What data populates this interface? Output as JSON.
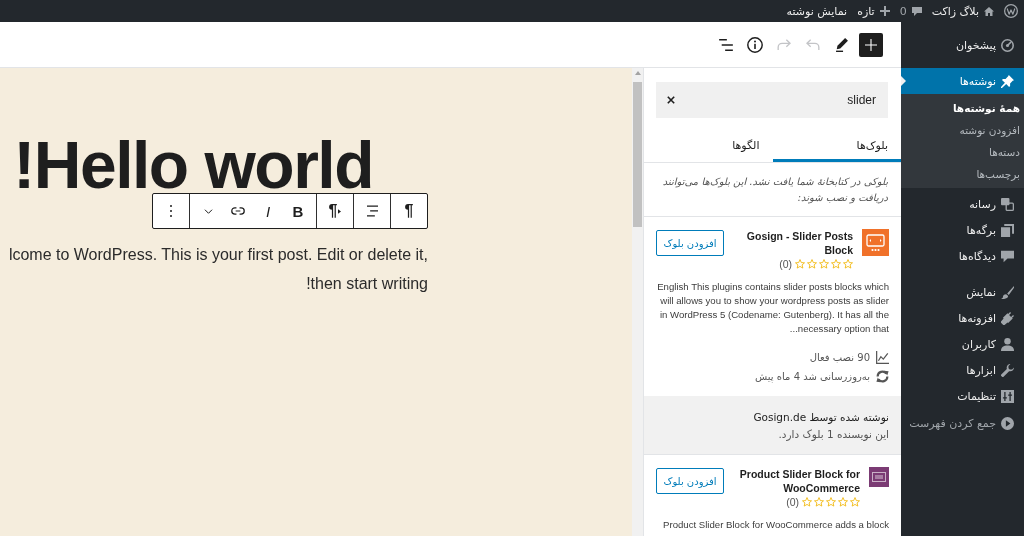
{
  "admin_bar": {
    "site_name": "بلاگ زاکت",
    "comments_count": "0",
    "new_label": "تازه",
    "view_post": "نمایش نوشته"
  },
  "sidebar": {
    "groups": [
      {
        "items": [
          {
            "label": "پیشخوان",
            "selected": false
          }
        ]
      },
      {
        "items": [
          {
            "label": "نوشته‌ها",
            "selected": true,
            "children": [
              {
                "label": "همهٔ نوشته‌ها",
                "selected": true
              },
              {
                "label": "افزودن نوشته",
                "selected": false
              },
              {
                "label": "دسته‌ها",
                "selected": false
              },
              {
                "label": "برچسب‌ها",
                "selected": false
              }
            ]
          },
          {
            "label": "رسانه",
            "selected": false
          },
          {
            "label": "برگه‌ها",
            "selected": false
          },
          {
            "label": "دیدگاه‌ها",
            "selected": false
          }
        ]
      },
      {
        "items": [
          {
            "label": "نمایش",
            "selected": false
          },
          {
            "label": "افزونه‌ها",
            "selected": false
          },
          {
            "label": "کاربران",
            "selected": false
          },
          {
            "label": "ابزارها",
            "selected": false
          },
          {
            "label": "تنظیمات",
            "selected": false
          }
        ]
      }
    ],
    "collapse_label": "جمع کردن فهرست"
  },
  "editor_toolbar": {
    "inserter": {
      "pressed": true
    },
    "undo": {
      "disabled": true
    },
    "redo": {
      "disabled": true
    }
  },
  "post": {
    "title": "Hello world!",
    "paragraph": "lcome to WordPress. This is your first post. Edit or delete it, then start writing!"
  },
  "block_toolbar": {
    "block_type": "¶",
    "text_direction": "¶",
    "bold": "B",
    "italic": "I"
  },
  "inserter": {
    "search": {
      "value": "slider"
    },
    "tabs": [
      {
        "label": "بلوک‌ها",
        "selected": true
      },
      {
        "label": "الگوها",
        "selected": false
      }
    ],
    "notice": "بلوکی در کتابخانهٔ شما یافت نشد. این بلوک‌ها می‌توانند دریافت و نصب شوند:",
    "results": [
      {
        "title": "Gosign - Slider Posts Block",
        "color": "#f0712a",
        "stars": 0,
        "rating_count": "(0)",
        "button": "افزودن بلوک",
        "description": "English This plugins contains slider posts blocks which will allows you to show your wordpress posts as slider in WordPress 5 (Codename: Gutenberg). It has all the necessary option that...",
        "active_installs": "90 نصب فعال",
        "updated": "به‌روزرسانی شد 4 ماه پیش",
        "author": "نوشته شده توسط Gosign.de",
        "author_blocks": "این نویسنده 1 بلوک دارد."
      },
      {
        "title": "Product Slider Block for WooCommerce",
        "color": "#7b3b74",
        "stars": 0,
        "rating_count": "(0)",
        "button": "افزودن بلوک",
        "description": "Product Slider Block for WooCommerce adds a block"
      }
    ]
  }
}
